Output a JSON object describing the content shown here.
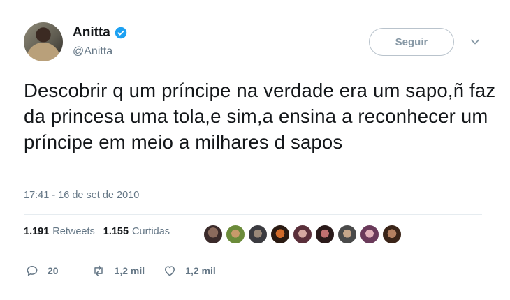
{
  "tweet": {
    "author_name": "Anitta",
    "author_handle": "@Anitta",
    "follow_label": "Seguir",
    "text": "Descobrir q um príncipe na verdade era um sapo,ñ faz da princesa uma tola,e sim,a ensina a reconhecer um príncipe em meio a milhares d sapos",
    "timestamp": "17:41 - 16 de set de 2010"
  },
  "stats": {
    "retweets_count": "1.191",
    "retweets_label": "Retweets",
    "likes_count": "1.155",
    "likes_label": "Curtidas"
  },
  "actions": {
    "replies": "20",
    "retweets": "1,2 mil",
    "likes": "1,2 mil"
  },
  "colors": {
    "verified": "#1da1f2",
    "muted": "#657786",
    "border": "#e6ecf0"
  },
  "icons": [
    "verified-badge-icon",
    "chevron-down-icon",
    "reply-icon",
    "retweet-icon",
    "heart-icon"
  ]
}
